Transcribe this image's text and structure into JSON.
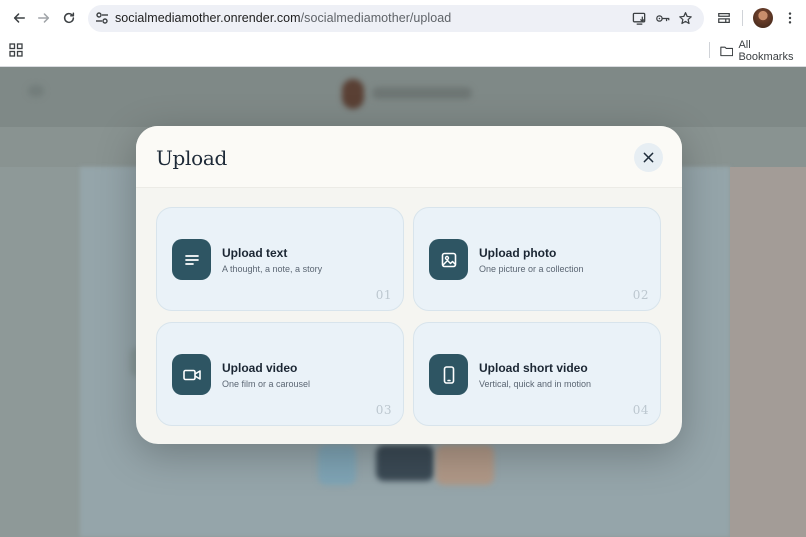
{
  "browser": {
    "url_host": "socialmediamother.onrender.com",
    "url_path": "/socialmediamother/upload",
    "bookmarks_label": "All Bookmarks"
  },
  "modal": {
    "title": "Upload",
    "options": [
      {
        "title": "Upload text",
        "subtitle": "A thought, a note, a story",
        "number": "01",
        "icon": "text-lines-icon"
      },
      {
        "title": "Upload photo",
        "subtitle": "One picture or a collection",
        "number": "02",
        "icon": "image-icon"
      },
      {
        "title": "Upload video",
        "subtitle": "One film or a carousel",
        "number": "03",
        "icon": "video-camera-icon"
      },
      {
        "title": "Upload short video",
        "subtitle": "Vertical, quick and in motion",
        "number": "04",
        "icon": "phone-portrait-icon"
      }
    ]
  },
  "colors": {
    "icon_tile": "#2e5563",
    "card_bg": "#eaf2f8",
    "modal_bg": "#f5f5f1"
  }
}
